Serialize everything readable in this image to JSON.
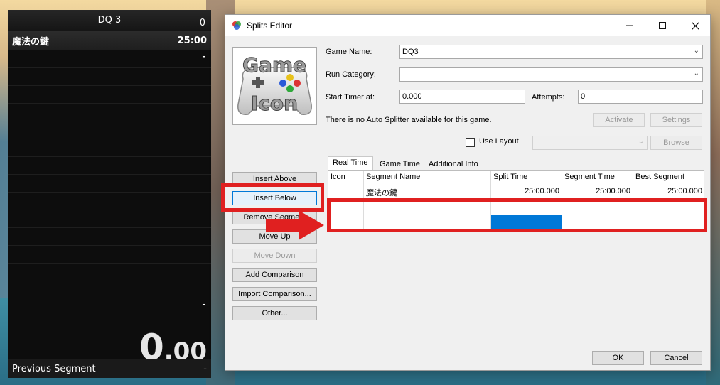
{
  "timer": {
    "title": "DQ 3",
    "attempts": "0",
    "segment_name": "魔法の鍵",
    "segment_time": "25:00",
    "delta_dash": "-",
    "final_dash": "-",
    "time_main": "0",
    "time_fraction": ".00",
    "prev_label": "Previous Segment",
    "prev_value": "-"
  },
  "window": {
    "title": "Splits Editor",
    "minimize_icon": "minimize-icon",
    "maximize_icon": "maximize-icon",
    "close_icon": "close-icon"
  },
  "game_icon": {
    "line1": "Game",
    "line2": "Icon"
  },
  "form": {
    "game_name_label": "Game Name:",
    "game_name_value": "DQ3",
    "run_category_label": "Run Category:",
    "run_category_value": "",
    "start_timer_label": "Start Timer at:",
    "start_timer_value": "0.000",
    "attempts_label": "Attempts:",
    "attempts_value": "0",
    "autosplitter_text": "There is no Auto Splitter available for this game.",
    "activate_label": "Activate",
    "settings_label": "Settings",
    "use_layout_label": "Use Layout",
    "layout_value": "",
    "browse_label": "Browse"
  },
  "side_buttons": {
    "insert_above": "Insert Above",
    "insert_below": "Insert Below",
    "remove_segment": "Remove Segment",
    "move_up": "Move Up",
    "move_down": "Move Down",
    "add_comparison": "Add Comparison",
    "import_comparison": "Import Comparison...",
    "other": "Other..."
  },
  "tabs": [
    "Real Time",
    "Game Time",
    "Additional Info"
  ],
  "grid": {
    "columns": [
      "Icon",
      "Segment Name",
      "Split Time",
      "Segment Time",
      "Best Segment"
    ],
    "rows": [
      [
        "",
        "魔法の鍵",
        "25:00.000",
        "25:00.000",
        "25:00.000"
      ],
      [
        "",
        "",
        "",
        "",
        ""
      ],
      [
        "",
        "",
        "",
        "",
        ""
      ]
    ]
  },
  "footer": {
    "ok": "OK",
    "cancel": "Cancel"
  },
  "colors": {
    "annotation_red": "#e02020",
    "selection_blue": "#0078d7"
  }
}
